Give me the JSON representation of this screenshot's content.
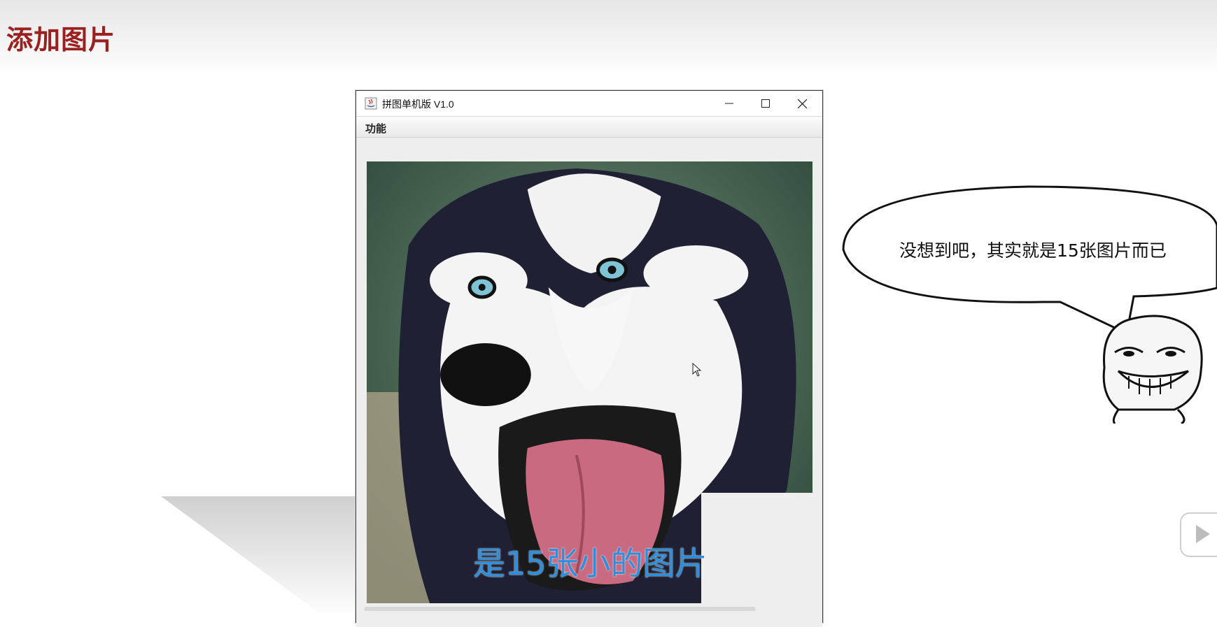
{
  "slide": {
    "title": "添加图片"
  },
  "window": {
    "title": "拼图单机版 V1.0",
    "menu": [
      "功能"
    ]
  },
  "puzzle": {
    "rows": 4,
    "cols": 4,
    "tile_count": 15,
    "empty_tile": "bottom-right"
  },
  "bubble": {
    "text": "没想到吧，其实就是15张图片而已"
  },
  "subtitle": {
    "text": "是15张小的图片"
  },
  "icons": [
    "java-icon",
    "minimize-icon",
    "maximize-icon",
    "close-icon",
    "cursor-icon",
    "play-icon"
  ],
  "colors": {
    "title": "#9b2020",
    "subtitle": "#2b8fde"
  }
}
